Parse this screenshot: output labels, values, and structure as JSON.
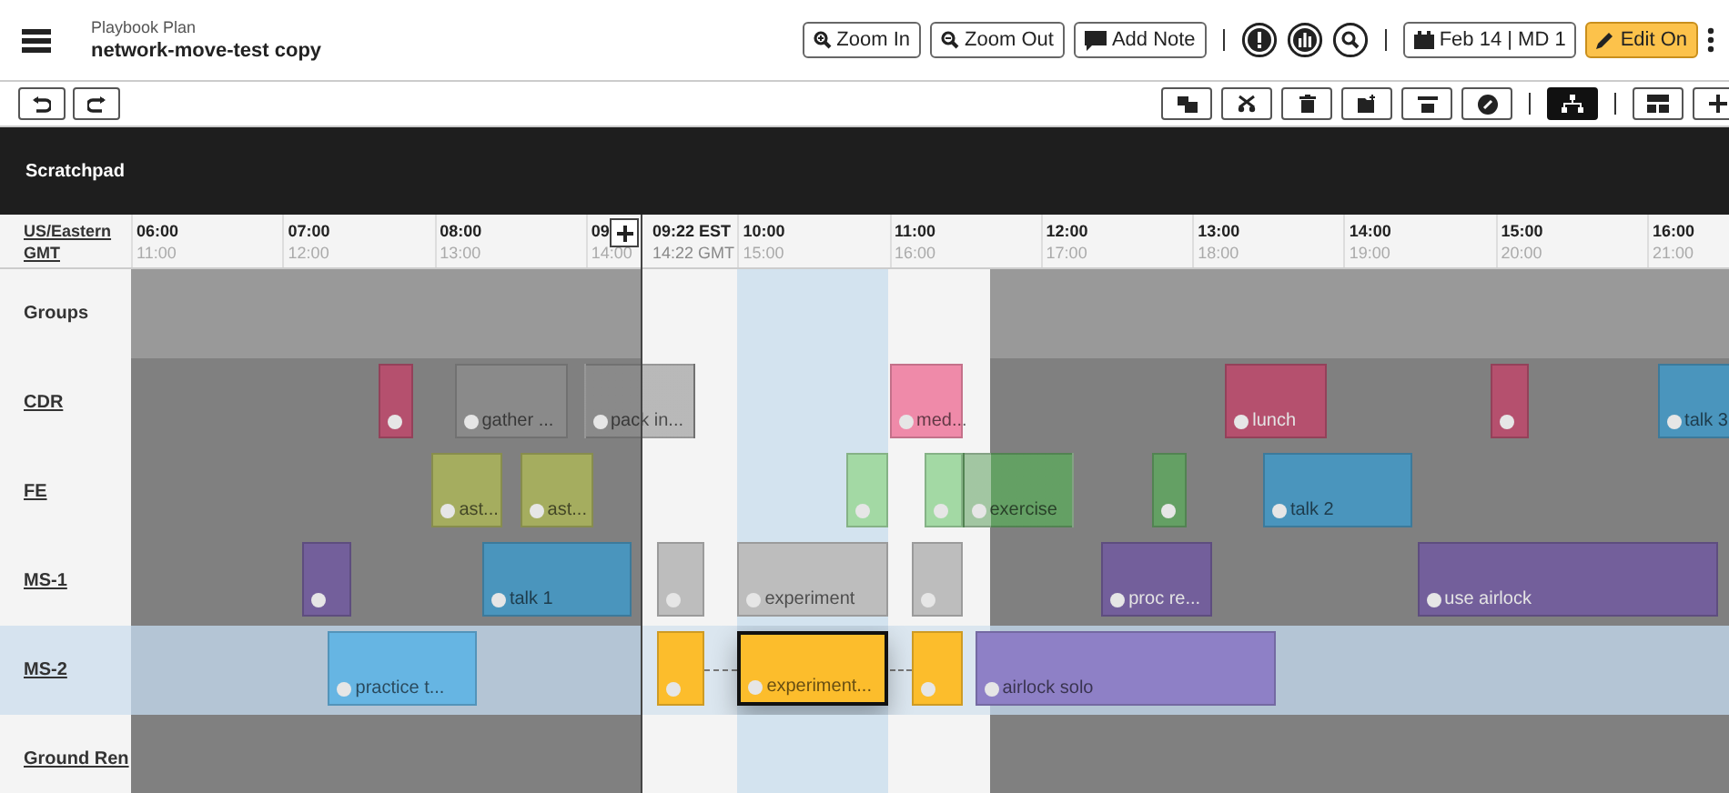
{
  "header": {
    "app": "Playbook Plan",
    "plan": "network-move-test copy"
  },
  "top_buttons": [
    {
      "label": "Zoom In"
    },
    {
      "label": "Zoom Out"
    },
    {
      "label": "Add Note"
    }
  ],
  "date_button": "Feb 14 | MD 1",
  "edit_mode": {
    "label": "Edit On",
    "on": true
  },
  "tools": [
    {
      "selected": false
    },
    {
      "selected": false
    },
    {
      "selected": false
    },
    {
      "selected": false
    },
    {
      "selected": false
    },
    {
      "selected": false
    },
    {
      "selected": true
    },
    {
      "selected": false
    },
    {
      "selected": false
    }
  ],
  "scratchpad": {
    "title": "Scratchpad"
  },
  "timeline": {
    "zone": "US/Eastern",
    "zone2": "GMT",
    "ticks": [
      {
        "label": "06:00",
        "sub": "11:00"
      },
      {
        "label": "07:00",
        "sub": "12:00"
      },
      {
        "label": "08:00",
        "sub": "13:00"
      },
      {
        "label": "09",
        "sub": "14:00"
      },
      {
        "label": "10:00",
        "sub": "15:00"
      },
      {
        "label": "11:00",
        "sub": "16:00"
      },
      {
        "label": "12:00",
        "sub": "17:00"
      },
      {
        "label": "13:00",
        "sub": "18:00"
      },
      {
        "label": "14:00",
        "sub": "19:00"
      },
      {
        "label": "15:00",
        "sub": "20:00"
      },
      {
        "label": "16:00",
        "sub": "21:00"
      }
    ],
    "now": {
      "label": "09:22 EST",
      "sub": "14:22 GMT"
    }
  },
  "rows": [
    {
      "label": "Groups",
      "kind": "groups",
      "selected": false,
      "activities": []
    },
    {
      "label": "CDR",
      "kind": "crew",
      "selected": false,
      "activities": [
        {
          "color": "#b5506e",
          "selected": false
        },
        {
          "label": "gather ...",
          "color": "#8a8a8a",
          "selected": false
        },
        {
          "label": "pack in...",
          "color": "#8a8a8a",
          "selected": false
        },
        {
          "label": "med...",
          "color": "#ef8aa9",
          "selected": false
        },
        {
          "label": "lunch",
          "color": "#b5506e",
          "selected": false
        },
        {
          "color": "#b5506e",
          "selected": false
        },
        {
          "label": "talk 3",
          "color": "#4a95bd",
          "selected": false
        }
      ]
    },
    {
      "label": "FE",
      "kind": "crew",
      "selected": false,
      "activities": [
        {
          "label": "ast...",
          "color": "#a5ad5f",
          "selected": false
        },
        {
          "label": "ast...",
          "color": "#a5ad5f",
          "selected": false
        },
        {
          "color": "#a3d9a4",
          "selected": false
        },
        {
          "color": "#a3d9a4",
          "selected": false
        },
        {
          "label": "exercise",
          "color": "#64a064",
          "selected": false
        },
        {
          "color": "#64a064",
          "selected": false
        },
        {
          "label": "talk 2",
          "color": "#4a95bd",
          "selected": false
        }
      ]
    },
    {
      "label": "MS-1",
      "kind": "crew",
      "selected": false,
      "activities": [
        {
          "color": "#735f9b",
          "selected": false
        },
        {
          "label": "talk 1",
          "color": "#4a95bd",
          "selected": false
        },
        {
          "color": "#bdbdbd",
          "selected": false
        },
        {
          "label": "experiment",
          "color": "#bdbdbd",
          "selected": false
        },
        {
          "color": "#bdbdbd",
          "selected": false
        },
        {
          "label": "proc re...",
          "color": "#735f9b",
          "selected": false
        },
        {
          "label": "use airlock",
          "color": "#735f9b",
          "selected": false
        }
      ]
    },
    {
      "label": "MS-2",
      "kind": "crew",
      "selected": true,
      "activities": [
        {
          "label": "practice t...",
          "color": "#66b5e3",
          "selected": false
        },
        {
          "color": "#fcbd2c",
          "selected": false,
          "linked": true
        },
        {
          "label": "experiment...",
          "color": "#fcbd2c",
          "selected": true,
          "linked": true
        },
        {
          "color": "#fcbd2c",
          "selected": false
        },
        {
          "label": "airlock solo",
          "color": "#8e80c6",
          "selected": false
        }
      ]
    },
    {
      "label": "Ground Ren",
      "kind": "crew",
      "selected": false,
      "activities": []
    }
  ]
}
